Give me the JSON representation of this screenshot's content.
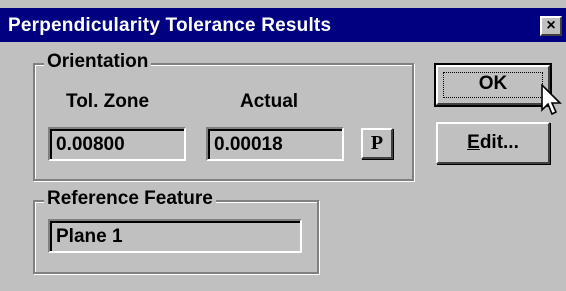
{
  "window": {
    "title": "Perpendicularity Tolerance Results",
    "close_glyph": "×"
  },
  "orientation": {
    "group_label": "Orientation",
    "tol_zone_label": "Tol. Zone",
    "actual_label": "Actual",
    "tol_zone_value": "0.00800",
    "actual_value": "0.00018",
    "p_button_label": "P"
  },
  "reference": {
    "group_label": "Reference Feature",
    "value": "Plane 1"
  },
  "buttons": {
    "ok_label": "OK",
    "edit_label": "Edit..."
  }
}
